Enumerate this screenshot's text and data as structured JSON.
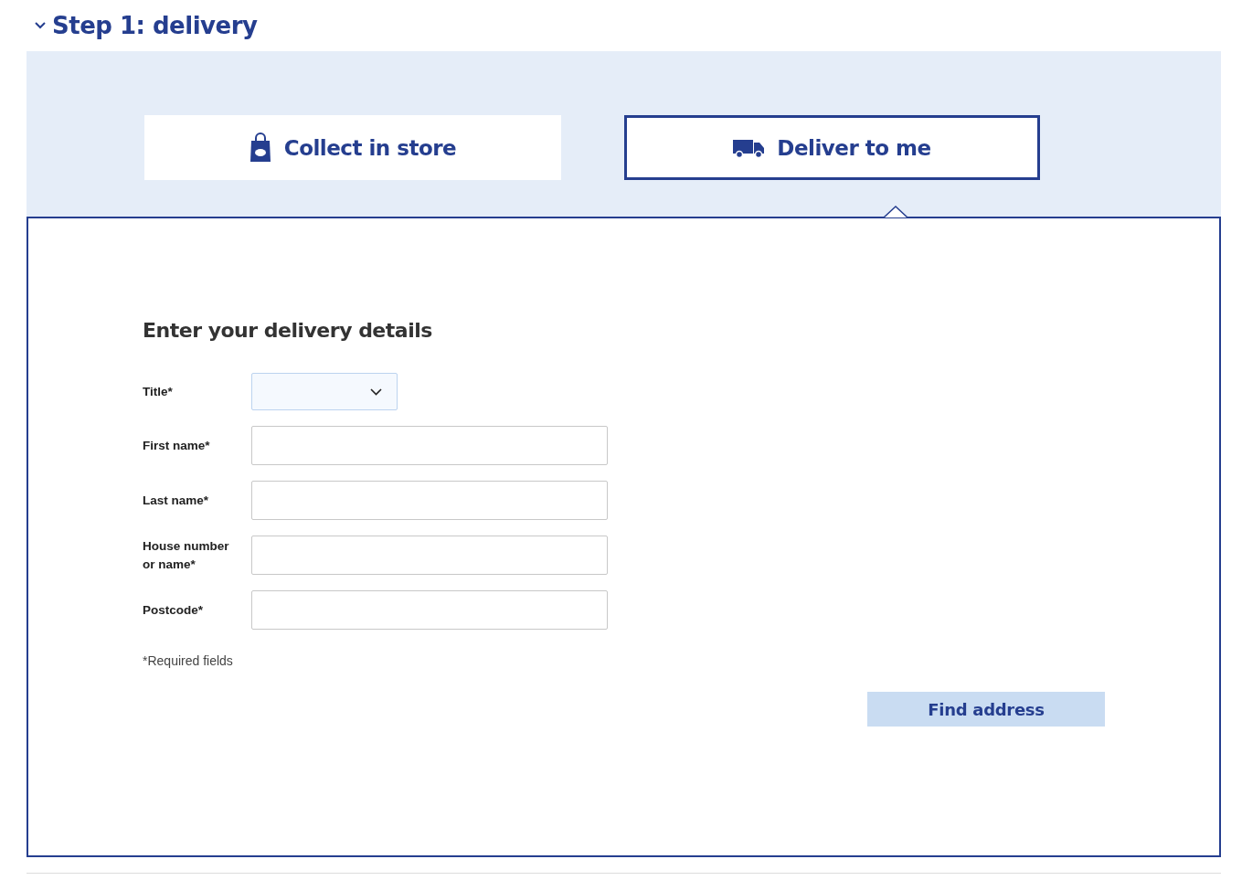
{
  "section": {
    "title": "Step 1: delivery",
    "expanded": true
  },
  "tabs": [
    {
      "label": "Collect in store",
      "kind": "store",
      "selected": false
    },
    {
      "label": "Deliver to me",
      "kind": "delivery",
      "selected": true
    }
  ],
  "form": {
    "heading": "Enter your delivery details",
    "fields": [
      {
        "label": "Title*",
        "kind": "select"
      },
      {
        "label": "First name*",
        "kind": "text"
      },
      {
        "label": "Last name*",
        "kind": "text"
      },
      {
        "label": "House number or name*",
        "kind": "text"
      },
      {
        "label": "Postcode*",
        "kind": "text"
      }
    ],
    "note": "*Required fields",
    "button": "Find address"
  }
}
